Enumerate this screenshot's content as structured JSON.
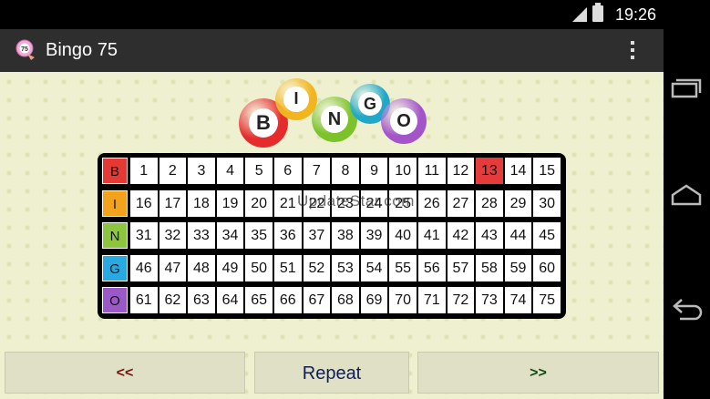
{
  "status": {
    "time": "19:26"
  },
  "app": {
    "title": "Bingo 75",
    "icon": "bingo-ball-app-icon"
  },
  "logo": {
    "letters": [
      "B",
      "I",
      "N",
      "G",
      "O"
    ],
    "colors": [
      "#e52b2b",
      "#f2b51d",
      "#7cc22a",
      "#21a8c8",
      "#a354c9"
    ]
  },
  "board": {
    "rows": [
      {
        "letter": "B",
        "color": "#e53935",
        "numbers": [
          "1",
          "2",
          "3",
          "4",
          "5",
          "6",
          "7",
          "8",
          "9",
          "10",
          "11",
          "12",
          "13",
          "14",
          "15"
        ]
      },
      {
        "letter": "I",
        "color": "#f3a31b",
        "numbers": [
          "16",
          "17",
          "18",
          "19",
          "20",
          "21",
          "22",
          "23",
          "24",
          "25",
          "26",
          "27",
          "28",
          "29",
          "30"
        ]
      },
      {
        "letter": "N",
        "color": "#8cc63f",
        "numbers": [
          "31",
          "32",
          "33",
          "34",
          "35",
          "36",
          "37",
          "38",
          "39",
          "40",
          "41",
          "42",
          "43",
          "44",
          "45"
        ]
      },
      {
        "letter": "G",
        "color": "#29a9e1",
        "numbers": [
          "46",
          "47",
          "48",
          "49",
          "50",
          "51",
          "52",
          "53",
          "54",
          "55",
          "56",
          "57",
          "58",
          "59",
          "60"
        ]
      },
      {
        "letter": "O",
        "color": "#9b59c7",
        "numbers": [
          "61",
          "62",
          "63",
          "64",
          "65",
          "66",
          "67",
          "68",
          "69",
          "70",
          "71",
          "72",
          "73",
          "74",
          "75"
        ]
      }
    ],
    "called": [
      "13"
    ],
    "called_color": "#e63b3b"
  },
  "watermark": "UpdateStar.com",
  "buttons": {
    "prev": "<<",
    "repeat": "Repeat",
    "next": ">>"
  },
  "nav": {
    "back": "back-icon",
    "home": "home-icon",
    "recents": "recents-icon"
  }
}
